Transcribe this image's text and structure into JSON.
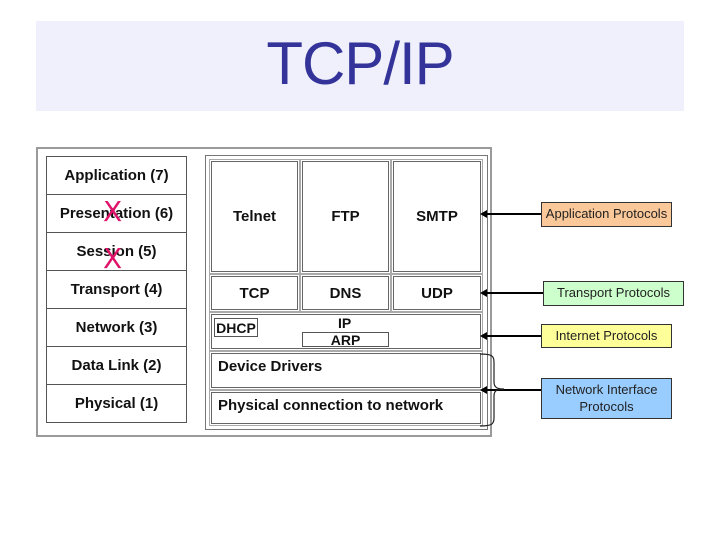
{
  "slide": {
    "title": "TCP/IP"
  },
  "osi_model": {
    "layers": [
      {
        "label": "Application (7)",
        "excluded": false
      },
      {
        "label": "Presentation (6)",
        "excluded": true
      },
      {
        "label": "Session (5)",
        "excluded": true
      },
      {
        "label": "Transport (4)",
        "excluded": false
      },
      {
        "label": "Network (3)",
        "excluded": false
      },
      {
        "label": "Data Link (2)",
        "excluded": false
      },
      {
        "label": "Physical (1)",
        "excluded": false
      }
    ],
    "excluded_mark": "X",
    "excluded_mark_color": "#e0136a"
  },
  "tcpip_stack": {
    "application": [
      "Telnet",
      "FTP",
      "SMTP"
    ],
    "transport": [
      "TCP",
      "DNS",
      "UDP"
    ],
    "internet": {
      "dhcp": "DHCP",
      "ip": "IP",
      "arp": "ARP"
    },
    "device_drivers": "Device Drivers",
    "physical": "Physical connection to network"
  },
  "protocol_labels": [
    {
      "label": "Application Protocols",
      "color": "#fbc899"
    },
    {
      "label": "Transport Protocols",
      "color": "#ccffcc"
    },
    {
      "label": "Internet Protocols",
      "color": "#ffff99"
    },
    {
      "label": "Network Interface Protocols",
      "color": "#99ccff"
    }
  ],
  "colors": {
    "title": "#333399",
    "title_background": "#eff0fb"
  }
}
